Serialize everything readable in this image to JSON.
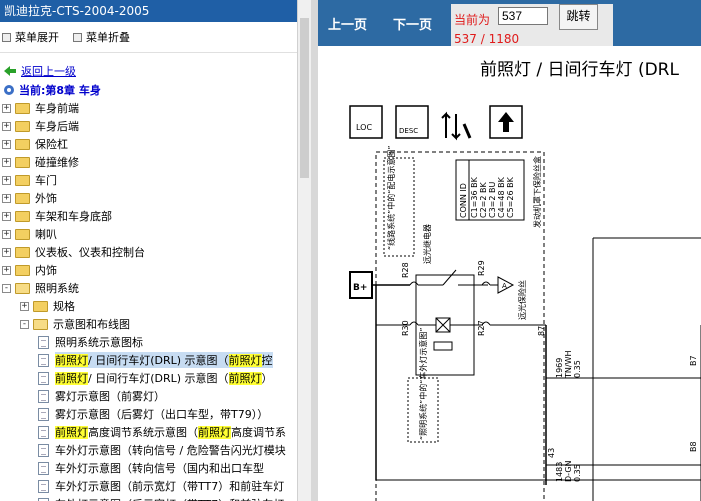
{
  "left": {
    "title": "凯迪拉克-CTS-2004-2005",
    "toolbar": {
      "expand": "菜单展开",
      "collapse": "菜单折叠"
    },
    "back_link": "返回上一级",
    "current": "当前:第8章 车身",
    "tree": [
      {
        "label": "车身前端",
        "level": 0,
        "type": "folder",
        "state": "+"
      },
      {
        "label": "车身后端",
        "level": 0,
        "type": "folder",
        "state": "+"
      },
      {
        "label": "保险杠",
        "level": 0,
        "type": "folder",
        "state": "+"
      },
      {
        "label": "碰撞维修",
        "level": 0,
        "type": "folder",
        "state": "+"
      },
      {
        "label": "车门",
        "level": 0,
        "type": "folder",
        "state": "+"
      },
      {
        "label": "外饰",
        "level": 0,
        "type": "folder",
        "state": "+"
      },
      {
        "label": "车架和车身底部",
        "level": 0,
        "type": "folder",
        "state": "+"
      },
      {
        "label": "喇叭",
        "level": 0,
        "type": "folder",
        "state": "+"
      },
      {
        "label": "仪表板、仪表和控制台",
        "level": 0,
        "type": "folder",
        "state": "+"
      },
      {
        "label": "内饰",
        "level": 0,
        "type": "folder",
        "state": "+"
      },
      {
        "label": "照明系统",
        "level": 0,
        "type": "folder",
        "state": "-"
      },
      {
        "label": "规格",
        "level": 1,
        "type": "folder",
        "state": "+"
      },
      {
        "label": "示意图和布线图",
        "level": 1,
        "type": "folder",
        "state": "-"
      },
      {
        "label": "照明系统示意图标",
        "level": 2,
        "type": "doc"
      },
      {
        "segments": [
          [
            "前照灯",
            "hl"
          ],
          [
            "/ 日间行车灯(DRL) 示意图（",
            ""
          ],
          [
            "前照灯",
            "hl"
          ],
          [
            "控",
            ""
          ]
        ],
        "level": 2,
        "type": "doc",
        "selected": true
      },
      {
        "segments": [
          [
            "前照灯",
            "hl"
          ],
          [
            "/ 日间行车灯(DRL) 示意图（",
            ""
          ],
          [
            "前照灯",
            "hl"
          ],
          [
            "）",
            ""
          ]
        ],
        "level": 2,
        "type": "doc"
      },
      {
        "label": "雾灯示意图（前雾灯）",
        "level": 2,
        "type": "doc"
      },
      {
        "label": "雾灯示意图（后雾灯（出口车型，带T79））",
        "level": 2,
        "type": "doc"
      },
      {
        "segments": [
          [
            "前照灯",
            "hl"
          ],
          [
            "高度调节系统示意图（",
            ""
          ],
          [
            "前照灯",
            "hl"
          ],
          [
            "高度调节系",
            ""
          ]
        ],
        "level": 2,
        "type": "doc"
      },
      {
        "label": "车外灯示意图（转向信号 / 危险警告闪光灯模块",
        "level": 2,
        "type": "doc"
      },
      {
        "label": "车外灯示意图（转向信号（国内和出口车型",
        "level": 2,
        "type": "doc"
      },
      {
        "label": "车外灯示意图（前示宽灯（带TT7）和前驻车灯",
        "level": 2,
        "type": "doc"
      },
      {
        "label": "车外灯示意图（后示宽灯（带TT7）和前驻车灯",
        "level": 2,
        "type": "doc"
      }
    ]
  },
  "viewer": {
    "prev": "上一页",
    "next": "下一页",
    "current_label": "当前为",
    "page_value": "537",
    "go": "跳转",
    "page_count": "537 / 1180",
    "page_title": "前照灯 / 日间行车灯 (DRL",
    "diagram": {
      "conn_id": "CONN ID",
      "conn_rows": [
        "C1=36 BK",
        "C2=2 BK",
        "C3=2 BU",
        "C4=48 BK",
        "C5=26 BK"
      ],
      "side_note": "发动机罩下保险丝盒",
      "note1": "“线路系统”中的“配电示意图”",
      "relay_label": "远光继电器",
      "fuse_label": "远光保险丝",
      "note2": "“照明系统”中的“车外灯示意图”",
      "B_plus": "B+",
      "pins": [
        "R28",
        "R29",
        "R30",
        "R27",
        "87",
        "43",
        "B7",
        "B8"
      ],
      "wire1": [
        "1969",
        "TN/WH",
        "0.35"
      ],
      "wire2": [
        "1483",
        "D-GN",
        "0.35"
      ],
      "icon_loc": "LOC",
      "icon_desc": "DESC"
    }
  },
  "colors": {
    "nav_blue": "#2d6aa3",
    "title_blue": "#1f5fa6",
    "highlight": "#ffff33",
    "red": "#e01b1b"
  }
}
